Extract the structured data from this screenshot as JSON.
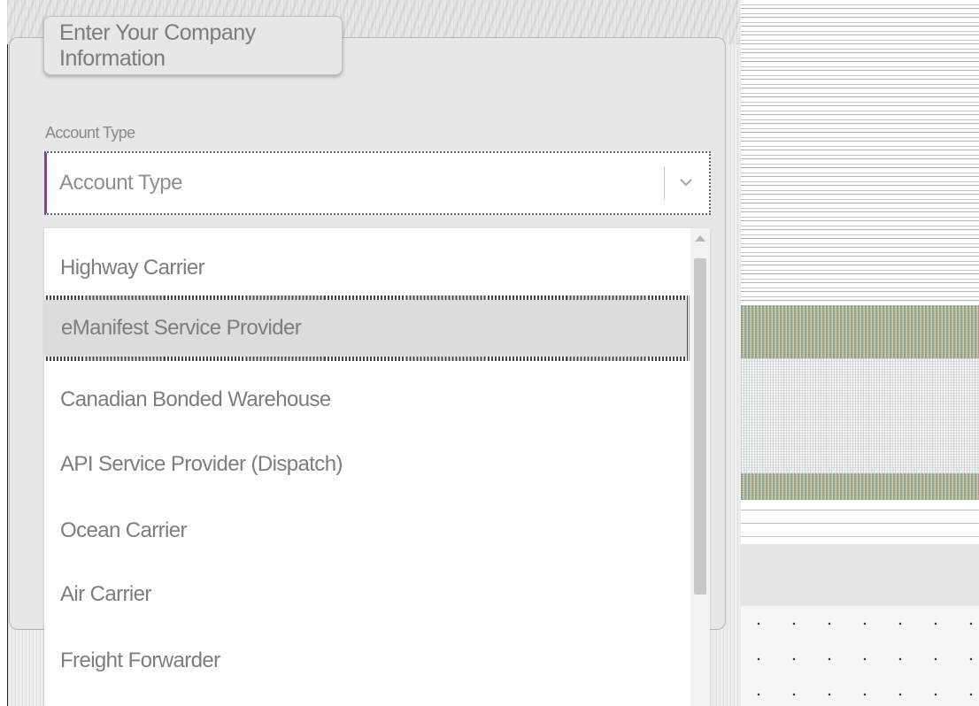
{
  "panel": {
    "tab_title": "Enter Your Company Information"
  },
  "account_type": {
    "label": "Account Type",
    "placeholder": "Account Type"
  },
  "dropdown": {
    "options": [
      "Highway Carrier",
      "eManifest Service Provider",
      "Canadian Bonded Warehouse",
      "API Service Provider (Dispatch)",
      "Ocean Carrier",
      "Air Carrier",
      "Freight Forwarder"
    ],
    "highlighted_index": 1
  },
  "icons": {
    "select": "chevron-down-icon",
    "scroll": "scroll-up-arrow-icon"
  },
  "colors": {
    "panel_bg": "#e7e7e7",
    "text": "#7d7d7d",
    "highlight_bg": "#dcdcdc"
  }
}
